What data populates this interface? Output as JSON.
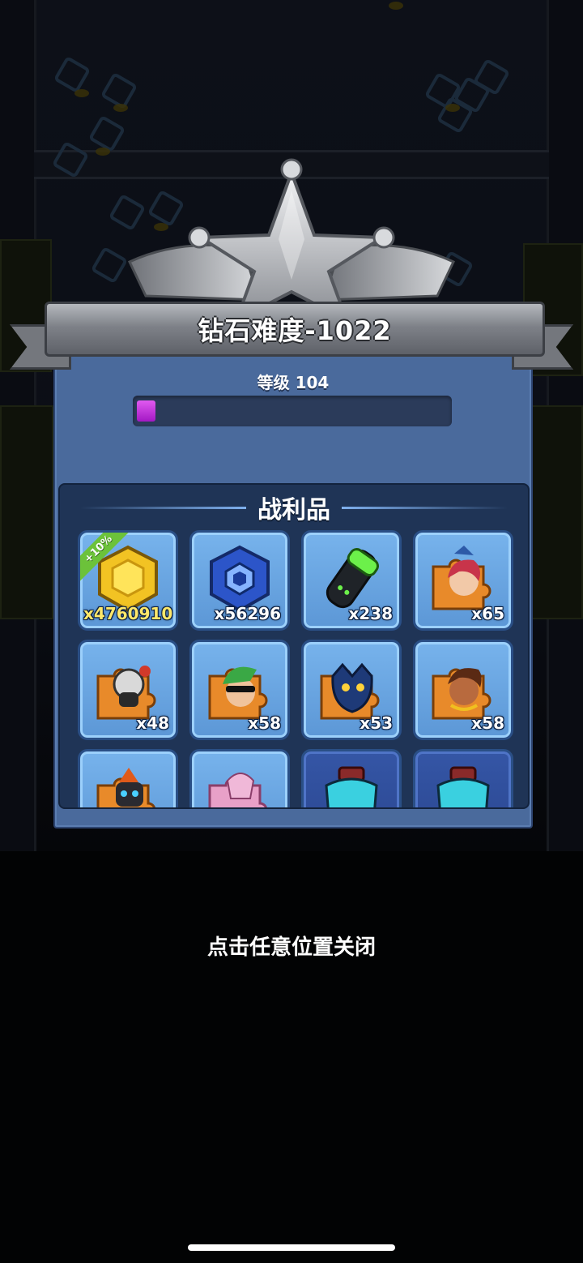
{
  "banner": {
    "title": "钻石难度-1022"
  },
  "level": {
    "label": "等级 104",
    "progress_fraction": 0.06
  },
  "loot": {
    "title": "战利品",
    "items": [
      {
        "name": "gold-coin-icon",
        "count": "x4760910",
        "badge": "+10%",
        "highlight": true
      },
      {
        "name": "blue-gem-icon",
        "count": "x56296"
      },
      {
        "name": "green-capsule-icon",
        "count": "x238"
      },
      {
        "name": "hero-puzzle-red-hair-icon",
        "count": "x65"
      },
      {
        "name": "hero-puzzle-gas-mask-icon",
        "count": "x48"
      },
      {
        "name": "hero-puzzle-green-hair-icon",
        "count": "x58"
      },
      {
        "name": "hero-puzzle-panther-icon",
        "count": "x53"
      },
      {
        "name": "hero-puzzle-warrior-woman-icon",
        "count": "x58"
      },
      {
        "name": "hero-puzzle-robot-icon",
        "count": ""
      },
      {
        "name": "hero-puzzle-pink-icon",
        "count": ""
      },
      {
        "name": "armor-chest-icon",
        "count": ""
      },
      {
        "name": "armor-chest-icon",
        "count": ""
      }
    ]
  },
  "hint": {
    "close": "点击任意位置关闭"
  },
  "colors": {
    "panel": "#4a6a9c",
    "loot_bg": "#1f3456",
    "progress_fill": "#c23ee0",
    "badge": "#6cc23a",
    "gold_count": "#ffe86a"
  }
}
